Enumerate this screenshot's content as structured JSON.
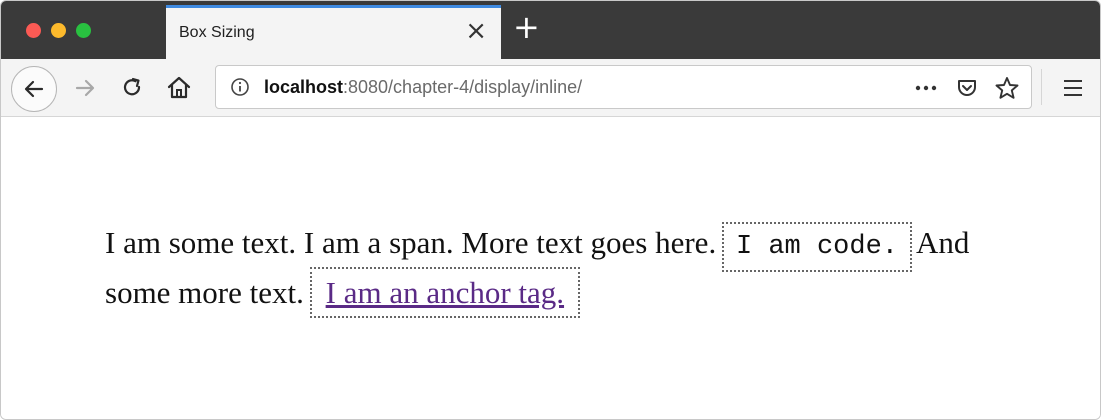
{
  "window": {
    "traffic_lights": [
      "close",
      "minimize",
      "zoom"
    ],
    "colors": {
      "close": "#fb5a54",
      "minimize": "#fdba2c",
      "zoom": "#29c140"
    }
  },
  "tab": {
    "title": "Box Sizing",
    "close_glyph": "×",
    "new_tab_glyph": "+",
    "accent": "#3f8ae0"
  },
  "toolbar": {
    "icons": [
      "back-arrow-icon",
      "forward-arrow-icon",
      "reload-icon",
      "home-icon",
      "info-icon",
      "more-actions-icon",
      "pocket-icon",
      "bookmark-star-icon",
      "hamburger-menu-icon"
    ]
  },
  "urlbar": {
    "host": "localhost",
    "rest": ":8080/chapter-4/display/inline/"
  },
  "page": {
    "text_1": "I am some text. I am a span. More text goes here.",
    "code": "I am code.",
    "text_2": "And some more text.",
    "anchor": "I am an anchor tag.",
    "anchor_color": "#5a2a86"
  }
}
